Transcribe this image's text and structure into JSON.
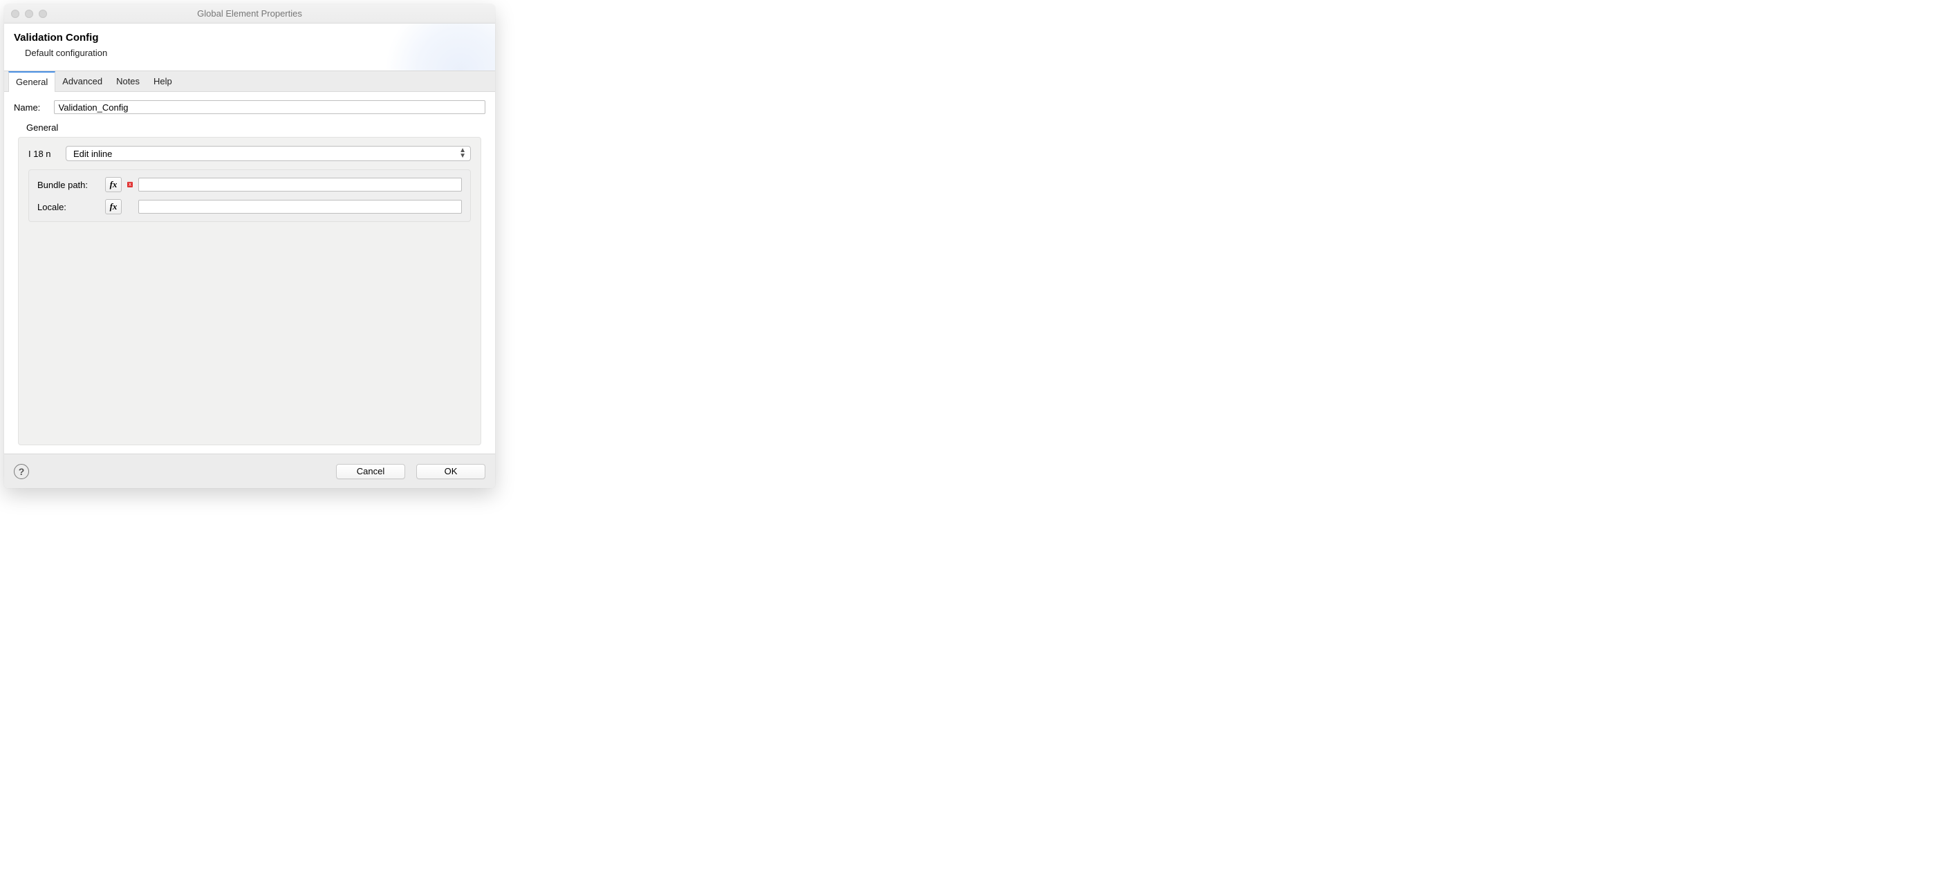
{
  "window": {
    "title": "Global Element Properties"
  },
  "header": {
    "title": "Validation Config",
    "subtitle": "Default configuration"
  },
  "tabs": [
    {
      "label": "General",
      "active": true
    },
    {
      "label": "Advanced",
      "active": false
    },
    {
      "label": "Notes",
      "active": false
    },
    {
      "label": "Help",
      "active": false
    }
  ],
  "form": {
    "name_label": "Name:",
    "name_value": "Validation_Config",
    "group_title": "General",
    "i18n_label": "I 18 n",
    "i18n_select_value": "Edit inline",
    "bundle_path_label": "Bundle path:",
    "bundle_path_value": "",
    "locale_label": "Locale:",
    "locale_value": "",
    "fx": "fx",
    "error_badge": "x"
  },
  "footer": {
    "help": "?",
    "cancel": "Cancel",
    "ok": "OK"
  }
}
